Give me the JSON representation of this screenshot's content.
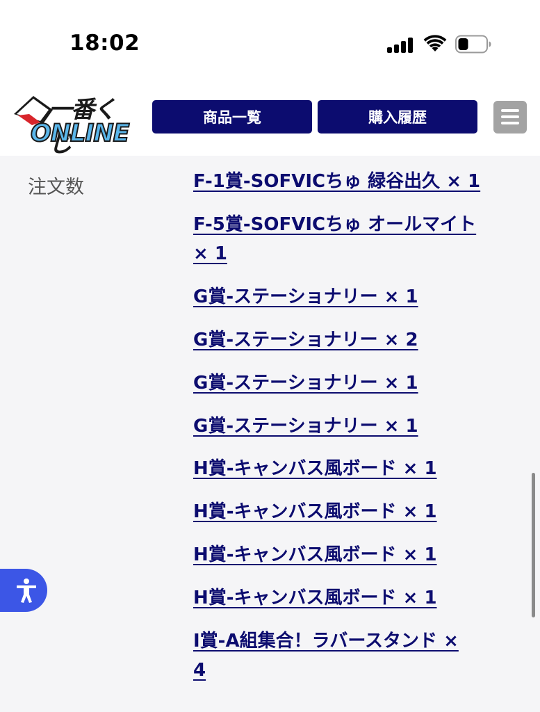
{
  "status": {
    "time": "18:02"
  },
  "header": {
    "logo_top": "一番くじ",
    "logo_bottom": "ONLINE",
    "nav": [
      {
        "label": "商品一覧"
      },
      {
        "label": "購入履歴"
      }
    ]
  },
  "order": {
    "label": "注文数",
    "items": [
      "F-1賞-SOFVICちゅ 緑谷出久 × 1",
      "F-5賞-SOFVICちゅ オールマイト",
      "× 1",
      "G賞-ステーショナリー × 1",
      "G賞-ステーショナリー × 2",
      "G賞-ステーショナリー × 1",
      "G賞-ステーショナリー × 1",
      "H賞-キャンバス風ボード × 1",
      "H賞-キャンバス風ボード × 1",
      "H賞-キャンバス風ボード × 1",
      "H賞-キャンバス風ボード × 1",
      "I賞-A組集合！ラバースタンド ×",
      "4"
    ]
  },
  "icons": {
    "signal": "cellular-signal-icon",
    "wifi": "wifi-icon",
    "battery": "battery-icon",
    "menu": "hamburger-menu-icon",
    "accessibility": "accessibility-icon"
  },
  "colors": {
    "nav_bg": "#0c0c6f",
    "link": "#0c0c6f",
    "menu_bg": "#a3a3a3",
    "a11y": "#3c56e6",
    "logo_blue": "#5ab6ea"
  }
}
